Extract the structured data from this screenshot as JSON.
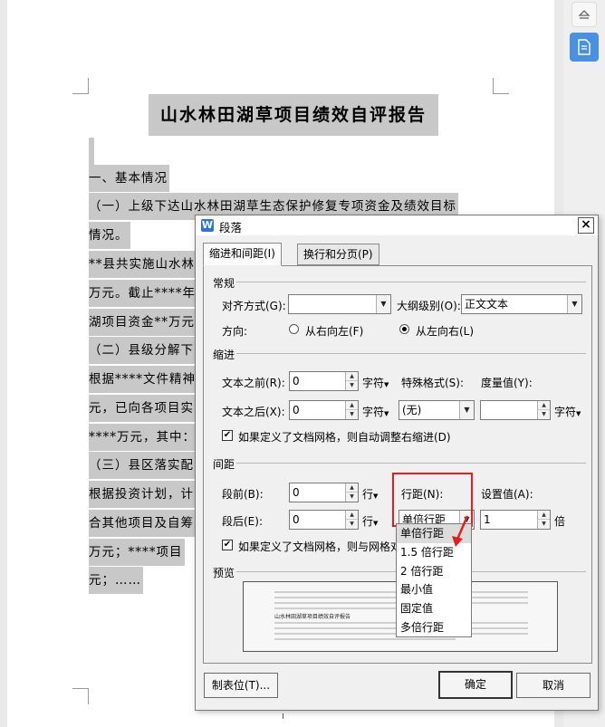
{
  "document": {
    "title": "山水林田湖草项目绩效自评报告",
    "lines": [
      "一、基本情况",
      "（一）上级下达山水林田湖草生态保护修复专项资金及绩效目标",
      "情况。",
      "**县共实施山水林",
      "万元。截止****年",
      "湖项目资金**万元",
      "（二）县级分解下",
      "根据****文件精神",
      "元，已向各项目实",
      "****万元，其中：",
      "（三）县区落实配",
      "根据投资计划，计",
      "合其他项目及自筹",
      "万元；****项目",
      "元；……"
    ]
  },
  "dialog": {
    "title": "段落",
    "logo": "W",
    "close": "×",
    "tabs": [
      "缩进和间距(I)",
      "换行和分页(P)"
    ],
    "general": {
      "section": "常规",
      "align_label": "对齐方式(G):",
      "align_value": "",
      "outline_label": "大纲级别(O):",
      "outline_value": "正文文本",
      "direction_label": "方向:",
      "rtl_label": "从右向左(F)",
      "ltr_label": "从左向右(L)"
    },
    "indent": {
      "section": "缩进",
      "before_label": "文本之前(R):",
      "before_value": "0",
      "before_unit": "字符",
      "after_label": "文本之后(X):",
      "after_value": "0",
      "after_unit": "字符",
      "special_label": "特殊格式(S):",
      "special_value": "(无)",
      "measure_label": "度量值(Y):",
      "measure_value": "",
      "measure_unit": "字符",
      "auto_adjust_label": "如果定义了文档网格，则自动调整右缩进(D)"
    },
    "spacing": {
      "section": "间距",
      "before_label": "段前(B):",
      "before_value": "0",
      "before_unit": "行",
      "after_label": "段后(E):",
      "after_value": "0",
      "after_unit": "行",
      "line_label": "行距(N):",
      "line_value": "单倍行距",
      "setting_label": "设置值(A):",
      "setting_value": "1",
      "setting_unit": "倍",
      "grid_label": "如果定义了文档网格，则与网格对"
    },
    "preview": {
      "section": "预览",
      "sample_text": "山水林田湖草项目绩效自评报告"
    },
    "buttons": {
      "tabs": "制表位(T)...",
      "ok": "确定",
      "cancel": "取消"
    },
    "line_spacing_options": [
      "单倍行距",
      "1.5 倍行距",
      "2 倍行距",
      "最小值",
      "固定值",
      "多倍行距"
    ],
    "arrow_glyph": "▾",
    "spin_up": "▲",
    "spin_down": "▼",
    "check_mark": "✔"
  },
  "colors": {
    "highlight": "#c8c8c8",
    "accent_red": "#e02020",
    "toolbar_blue": "#4a90e2"
  }
}
